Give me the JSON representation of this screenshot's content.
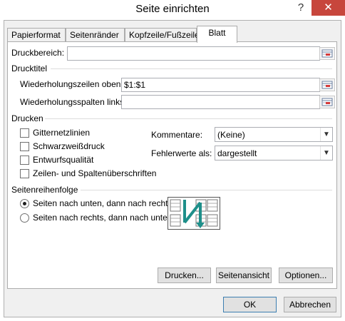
{
  "window": {
    "title": "Seite einrichten",
    "help_glyph": "?",
    "close_glyph": "✕"
  },
  "tabs": [
    {
      "label": "Papierformat",
      "active": false
    },
    {
      "label": "Seitenränder",
      "active": false
    },
    {
      "label": "Kopfzeile/Fußzeile",
      "active": false
    },
    {
      "label": "Blatt",
      "active": true
    }
  ],
  "print_area": {
    "label": "Druckbereich:",
    "value": ""
  },
  "print_titles": {
    "header": "Drucktitel",
    "rows_label": "Wiederholungszeilen oben:",
    "rows_value": "$1:$1",
    "cols_label": "Wiederholungsspalten links:",
    "cols_value": ""
  },
  "print": {
    "header": "Drucken",
    "checkboxes": [
      {
        "label": "Gitternetzlinien",
        "checked": false
      },
      {
        "label": "Schwarzweißdruck",
        "checked": false
      },
      {
        "label": "Entwurfsqualität",
        "checked": false
      },
      {
        "label": "Zeilen- und Spaltenüberschriften",
        "checked": false
      }
    ],
    "comments_label": "Kommentare:",
    "comments_value": "(Keine)",
    "errors_label": "Fehlerwerte als:",
    "errors_value": "dargestellt"
  },
  "page_order": {
    "header": "Seitenreihenfolge",
    "options": [
      {
        "label": "Seiten nach unten, dann nach rechts",
        "selected": true
      },
      {
        "label": "Seiten nach rechts, dann nach unten",
        "selected": false
      }
    ]
  },
  "panel_buttons": {
    "print": "Drucken...",
    "preview": "Seitenansicht",
    "options": "Optionen..."
  },
  "footer": {
    "ok": "OK",
    "cancel": "Abbrechen"
  },
  "colors": {
    "close_bg": "#c7463c",
    "accent_arrow": "#1e8f8a"
  },
  "icons": {
    "ref": "collapse-dialog-icon",
    "dropdown": "chevron-down-icon"
  }
}
